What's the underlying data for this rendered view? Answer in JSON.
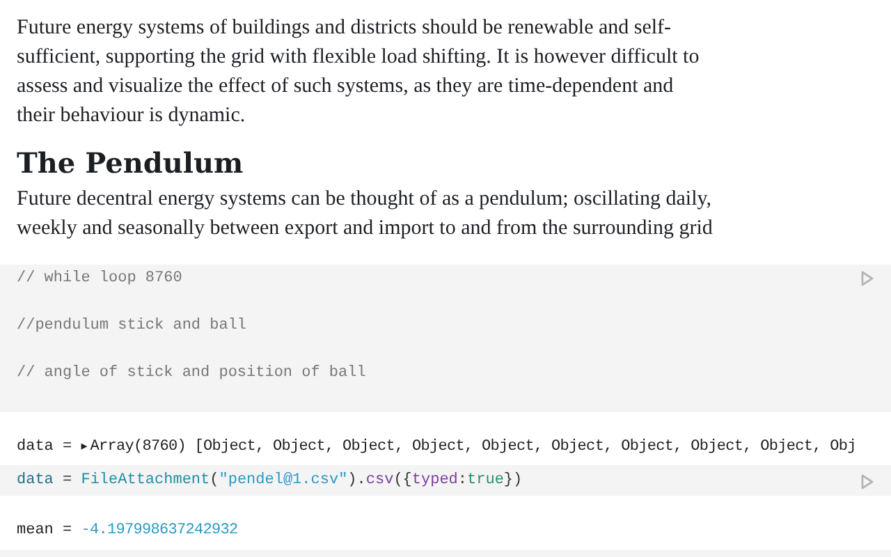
{
  "intro": "Future energy systems of buildings and districts should be renewable and self-sufficient, supporting the grid with flexible load shifting. It is however difficult to assess and visualize the effect of such systems, as they are time-dependent and their behaviour is dynamic.",
  "heading": "The Pendulum",
  "lead": "Future decentral energy systems can be thought of as a pendulum; oscillating daily, weekly and seasonally between export and import to and from the surrounding grid",
  "cells": [
    {
      "kind": "code",
      "lines": [
        "// while loop 8760",
        "//pendulum stick and ball",
        "// angle of stick and position of ball"
      ]
    },
    {
      "kind": "output",
      "name": "data = ",
      "toggle": "▸",
      "value": "Array(8760) [Object, Object, Object, Object, Object, Object, Object, Object, Object, Obj"
    },
    {
      "kind": "source",
      "tokens": [
        {
          "t": "data",
          "kind": "var"
        },
        {
          "t": " = ",
          "kind": "plain"
        },
        {
          "t": "FileAttachment",
          "kind": "fn"
        },
        {
          "t": "(",
          "kind": "plain"
        },
        {
          "t": "\"pendel@1.csv\"",
          "kind": "string"
        },
        {
          "t": ").",
          "kind": "plain"
        },
        {
          "t": "csv",
          "kind": "method"
        },
        {
          "t": "({",
          "kind": "plain"
        },
        {
          "t": "typed",
          "kind": "prop"
        },
        {
          "t": ":",
          "kind": "plain"
        },
        {
          "t": "true",
          "kind": "bool"
        },
        {
          "t": "})",
          "kind": "plain"
        }
      ]
    },
    {
      "kind": "number",
      "name": "mean = ",
      "value": "-4.197998637242932"
    }
  ]
}
